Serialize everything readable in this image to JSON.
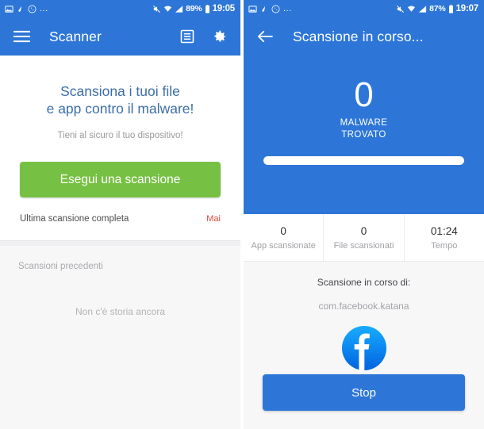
{
  "colors": {
    "brand_blue": "#2d76d8",
    "accent_green": "#76c043",
    "danger_red": "#e0483c",
    "headline_blue": "#3c6ea6",
    "page_bg": "#f7f7f8"
  },
  "left_screen": {
    "statusbar": {
      "left_icons": [
        "image-icon",
        "brush-icon",
        "whatsapp-icon"
      ],
      "overflow": "...",
      "right_icons": [
        "mute-icon",
        "wifi-icon",
        "signal-icon",
        "battery-icon"
      ],
      "battery_percent": "89%",
      "clock": "19:05"
    },
    "appbar": {
      "menu_icon": "hamburger-menu-icon",
      "title": "Scanner",
      "actions": [
        {
          "icon": "log-list-icon"
        },
        {
          "icon": "gear-icon"
        }
      ]
    },
    "headline_line1": "Scansiona i tuoi file",
    "headline_line2": "e app contro il malware!",
    "subheadline": "Tieni al sicuro il tuo dispositivo!",
    "primary_button": "Esegui una scansione",
    "last_scan_label": "Ultima scansione completa",
    "last_scan_value": "Mai",
    "history_title": "Scansioni precedenti",
    "history_empty": "Non c'è storia ancora"
  },
  "right_screen": {
    "statusbar": {
      "left_icons": [
        "image-icon",
        "brush-icon",
        "whatsapp-icon"
      ],
      "overflow": "...",
      "right_icons": [
        "mute-icon",
        "wifi-icon",
        "signal-icon",
        "battery-icon"
      ],
      "battery_percent": "87%",
      "clock": "19:07"
    },
    "appbar": {
      "back_icon": "arrow-back-icon",
      "title": "Scansione in corso..."
    },
    "hero": {
      "count": "0",
      "label_line1": "MALWARE",
      "label_line2": "TROVATO",
      "progress_percent": 100
    },
    "stats": [
      {
        "value": "0",
        "label": "App scansionate"
      },
      {
        "value": "0",
        "label": "File scansionati"
      },
      {
        "value": "01:24",
        "label": "Tempo"
      }
    ],
    "scanning": {
      "title": "Scansione in corso di:",
      "package": "com.facebook.katana",
      "app_icon": "facebook-icon"
    },
    "stop_button": "Stop"
  }
}
